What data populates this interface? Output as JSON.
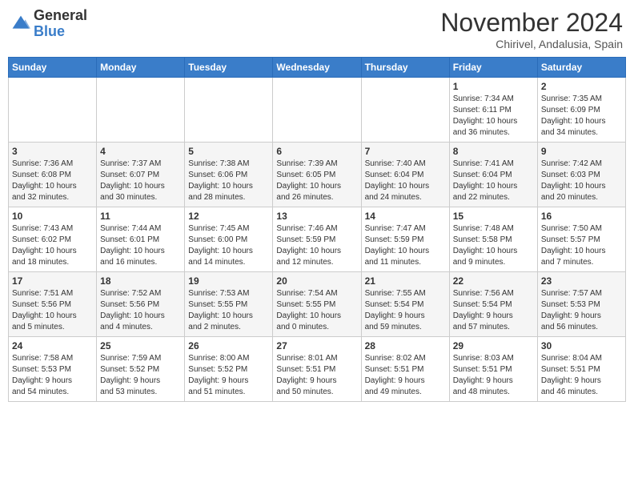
{
  "header": {
    "logo_general": "General",
    "logo_blue": "Blue",
    "month_year": "November 2024",
    "location": "Chirivel, Andalusia, Spain"
  },
  "weekdays": [
    "Sunday",
    "Monday",
    "Tuesday",
    "Wednesday",
    "Thursday",
    "Friday",
    "Saturday"
  ],
  "weeks": [
    [
      {
        "day": "",
        "info": ""
      },
      {
        "day": "",
        "info": ""
      },
      {
        "day": "",
        "info": ""
      },
      {
        "day": "",
        "info": ""
      },
      {
        "day": "",
        "info": ""
      },
      {
        "day": "1",
        "info": "Sunrise: 7:34 AM\nSunset: 6:11 PM\nDaylight: 10 hours\nand 36 minutes."
      },
      {
        "day": "2",
        "info": "Sunrise: 7:35 AM\nSunset: 6:09 PM\nDaylight: 10 hours\nand 34 minutes."
      }
    ],
    [
      {
        "day": "3",
        "info": "Sunrise: 7:36 AM\nSunset: 6:08 PM\nDaylight: 10 hours\nand 32 minutes."
      },
      {
        "day": "4",
        "info": "Sunrise: 7:37 AM\nSunset: 6:07 PM\nDaylight: 10 hours\nand 30 minutes."
      },
      {
        "day": "5",
        "info": "Sunrise: 7:38 AM\nSunset: 6:06 PM\nDaylight: 10 hours\nand 28 minutes."
      },
      {
        "day": "6",
        "info": "Sunrise: 7:39 AM\nSunset: 6:05 PM\nDaylight: 10 hours\nand 26 minutes."
      },
      {
        "day": "7",
        "info": "Sunrise: 7:40 AM\nSunset: 6:04 PM\nDaylight: 10 hours\nand 24 minutes."
      },
      {
        "day": "8",
        "info": "Sunrise: 7:41 AM\nSunset: 6:04 PM\nDaylight: 10 hours\nand 22 minutes."
      },
      {
        "day": "9",
        "info": "Sunrise: 7:42 AM\nSunset: 6:03 PM\nDaylight: 10 hours\nand 20 minutes."
      }
    ],
    [
      {
        "day": "10",
        "info": "Sunrise: 7:43 AM\nSunset: 6:02 PM\nDaylight: 10 hours\nand 18 minutes."
      },
      {
        "day": "11",
        "info": "Sunrise: 7:44 AM\nSunset: 6:01 PM\nDaylight: 10 hours\nand 16 minutes."
      },
      {
        "day": "12",
        "info": "Sunrise: 7:45 AM\nSunset: 6:00 PM\nDaylight: 10 hours\nand 14 minutes."
      },
      {
        "day": "13",
        "info": "Sunrise: 7:46 AM\nSunset: 5:59 PM\nDaylight: 10 hours\nand 12 minutes."
      },
      {
        "day": "14",
        "info": "Sunrise: 7:47 AM\nSunset: 5:59 PM\nDaylight: 10 hours\nand 11 minutes."
      },
      {
        "day": "15",
        "info": "Sunrise: 7:48 AM\nSunset: 5:58 PM\nDaylight: 10 hours\nand 9 minutes."
      },
      {
        "day": "16",
        "info": "Sunrise: 7:50 AM\nSunset: 5:57 PM\nDaylight: 10 hours\nand 7 minutes."
      }
    ],
    [
      {
        "day": "17",
        "info": "Sunrise: 7:51 AM\nSunset: 5:56 PM\nDaylight: 10 hours\nand 5 minutes."
      },
      {
        "day": "18",
        "info": "Sunrise: 7:52 AM\nSunset: 5:56 PM\nDaylight: 10 hours\nand 4 minutes."
      },
      {
        "day": "19",
        "info": "Sunrise: 7:53 AM\nSunset: 5:55 PM\nDaylight: 10 hours\nand 2 minutes."
      },
      {
        "day": "20",
        "info": "Sunrise: 7:54 AM\nSunset: 5:55 PM\nDaylight: 10 hours\nand 0 minutes."
      },
      {
        "day": "21",
        "info": "Sunrise: 7:55 AM\nSunset: 5:54 PM\nDaylight: 9 hours\nand 59 minutes."
      },
      {
        "day": "22",
        "info": "Sunrise: 7:56 AM\nSunset: 5:54 PM\nDaylight: 9 hours\nand 57 minutes."
      },
      {
        "day": "23",
        "info": "Sunrise: 7:57 AM\nSunset: 5:53 PM\nDaylight: 9 hours\nand 56 minutes."
      }
    ],
    [
      {
        "day": "24",
        "info": "Sunrise: 7:58 AM\nSunset: 5:53 PM\nDaylight: 9 hours\nand 54 minutes."
      },
      {
        "day": "25",
        "info": "Sunrise: 7:59 AM\nSunset: 5:52 PM\nDaylight: 9 hours\nand 53 minutes."
      },
      {
        "day": "26",
        "info": "Sunrise: 8:00 AM\nSunset: 5:52 PM\nDaylight: 9 hours\nand 51 minutes."
      },
      {
        "day": "27",
        "info": "Sunrise: 8:01 AM\nSunset: 5:51 PM\nDaylight: 9 hours\nand 50 minutes."
      },
      {
        "day": "28",
        "info": "Sunrise: 8:02 AM\nSunset: 5:51 PM\nDaylight: 9 hours\nand 49 minutes."
      },
      {
        "day": "29",
        "info": "Sunrise: 8:03 AM\nSunset: 5:51 PM\nDaylight: 9 hours\nand 48 minutes."
      },
      {
        "day": "30",
        "info": "Sunrise: 8:04 AM\nSunset: 5:51 PM\nDaylight: 9 hours\nand 46 minutes."
      }
    ]
  ]
}
